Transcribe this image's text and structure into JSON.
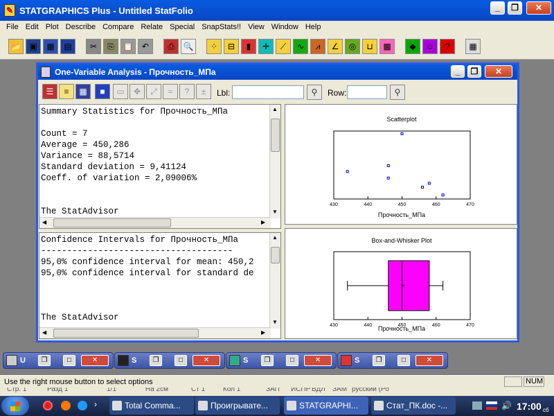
{
  "app": {
    "title": "STATGRAPHICS Plus - Untitled StatFolio",
    "icon": "statgraphics-icon"
  },
  "menu": [
    "File",
    "Edit",
    "Plot",
    "Describe",
    "Compare",
    "Relate",
    "Special",
    "SnapStats!!",
    "View",
    "Window",
    "Help"
  ],
  "toolbar_icons": [
    "open-folder-icon",
    "save-icon",
    "spreadsheet-icon",
    "save-data-icon",
    "cut-icon",
    "copy-icon",
    "paste-icon",
    "undo-icon",
    "print-icon",
    "print-preview-icon",
    "scatter-icon",
    "boxplot-icon",
    "histogram-icon",
    "target-icon",
    "regression-icon",
    "control-chart-icon",
    "normal-curve-icon",
    "line-chart-icon",
    "globe-icon",
    "steps-icon",
    "glm-icon",
    "diamond-icon",
    "person-icon",
    "help-icon",
    "calculator-icon"
  ],
  "child": {
    "title": "One-Variable Analysis - Прочность_МПа",
    "lbl_label": "Lbl:",
    "row_label": "Row:",
    "summary_lines": [
      "Summary Statistics for Прочность_МПа",
      "",
      "Count = 7",
      "Average = 450,286",
      "Variance = 88,5714",
      "Standard deviation = 9,41124",
      "Coeff. of variation = 2,09006%",
      "",
      "",
      "The StatAdvisor"
    ],
    "ci_lines": [
      "Confidence Intervals for Прочность_МПа",
      "-------------------------------------",
      "95,0% confidence interval for mean: 450,2",
      "95,0% confidence interval for standard de",
      "",
      "",
      "",
      "The StatAdvisor"
    ]
  },
  "scatter": {
    "title": "Scatterplot",
    "xlabel": "Прочность_МПа",
    "ticks": [
      "430",
      "440",
      "450",
      "460",
      "470"
    ]
  },
  "boxplot": {
    "title": "Box-and-Whisker Plot",
    "xlabel": "Прочность_МПа",
    "ticks": [
      "430",
      "440",
      "450",
      "460",
      "470"
    ]
  },
  "chart_data": [
    {
      "type": "scatter",
      "title": "Scatterplot",
      "xlabel": "Прочность_МПа",
      "xlim": [
        430,
        470
      ],
      "points": [
        {
          "x": 434,
          "y": 0.4
        },
        {
          "x": 446,
          "y": 0.49
        },
        {
          "x": 446,
          "y": 0.3
        },
        {
          "x": 450,
          "y": 0.98
        },
        {
          "x": 456,
          "y": 0.16
        },
        {
          "x": 458,
          "y": 0.22
        },
        {
          "x": 462,
          "y": 0.04
        }
      ],
      "point_color": "#0000cc"
    },
    {
      "type": "box",
      "title": "Box-and-Whisker Plot",
      "xlabel": "Прочность_МПа",
      "xlim": [
        430,
        470
      ],
      "min": 434,
      "q1": 446,
      "median": 450,
      "mean": 450.286,
      "q3": 458,
      "max": 462,
      "fill": "#ff00ff"
    }
  ],
  "mdi_windows": [
    {
      "label": "U",
      "icon": "data-window-icon"
    },
    {
      "label": "S",
      "icon": "statadvisor-icon"
    },
    {
      "label": "S",
      "icon": "analysis-icon"
    },
    {
      "label": "S",
      "icon": "graph-icon"
    }
  ],
  "status": {
    "text": "Use the right mouse button to select options",
    "num": "NUM"
  },
  "word_status": [
    "Стр. 1",
    "Разд 1",
    "1/1",
    "На 2см",
    "Ст 1",
    "Кол 1",
    "ЗАП",
    "ИСПР",
    "ВДЛ",
    "ЗАМ",
    "русский (Ро"
  ],
  "taskbar": {
    "items": [
      {
        "label": "Total Comma...",
        "icon": "total-commander-icon"
      },
      {
        "label": "Проигрывате...",
        "icon": "media-player-icon"
      },
      {
        "label": "STATGRAPHI...",
        "icon": "statgraphics-icon"
      },
      {
        "label": "Стат_ПК.doc -...",
        "icon": "word-icon"
      }
    ],
    "clock": "17:00",
    "clock_sub": "сб"
  }
}
